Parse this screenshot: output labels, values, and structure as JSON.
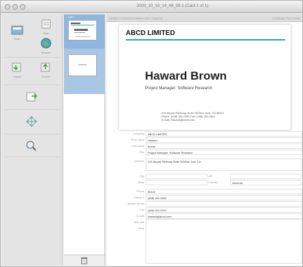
{
  "window": {
    "title": "2008_10_16_14_48_08-1 (Card 1 of 1)"
  },
  "toolbar": {
    "tools": [
      {
        "icon": "scan-icon",
        "label": "Scan"
      },
      {
        "icon": "new-card-icon",
        "label": "New"
      },
      {
        "icon": "globe-icon",
        "label": "Browse"
      },
      {
        "icon": "import-icon",
        "label": "Import"
      },
      {
        "icon": "export-icon",
        "label": "Export"
      }
    ],
    "rotate_icon": "rotate-icon",
    "fit_icon": "fit-arrows-icon",
    "zoom_icon": "zoom-icon"
  },
  "thumbnails": {
    "top_label": "Card",
    "trash_icon": "trash-icon"
  },
  "info_bar": {
    "left": "Quality of scanned business card: Adequate",
    "right": "Landscape  Print  Show"
  },
  "card": {
    "company": "ABCD LIMITED",
    "name": "Haward Brown",
    "title": "Project Manager: Software Research",
    "address_line": "226 Airport Parkway, Suite 250San Jose, CA 95110",
    "phone_line": "Phone: (408) 451-0000   Fax: (408) 451-0001",
    "email_line": "E-mail: Haward@abcd.com"
  },
  "form": {
    "fields": [
      {
        "label": "Company",
        "value": "ABCD LIMITED"
      },
      {
        "label": "First name",
        "value": "Haward"
      },
      {
        "label": "Last name",
        "value": "Brown"
      },
      {
        "label": "Title",
        "value": "Project Manager: Software Research"
      }
    ],
    "address": {
      "label": "Address",
      "value": "226 Airport Parkway Suite 250San Jose CA"
    },
    "city": {
      "label": "City",
      "value": ""
    },
    "state": {
      "label": "State",
      "value": ""
    },
    "zip": {
      "label": "ZIP",
      "value": ""
    },
    "country": {
      "label": "Country",
      "value": "Armenia"
    },
    "phone": {
      "label": "Phone",
      "value": "95110"
    },
    "phone2": {
      "label": "Phone 2",
      "value": "(408) 451-0000"
    },
    "mobile": {
      "label": "Mobile phone",
      "value": ""
    },
    "fax": {
      "label": "Fax",
      "value": "(408) 451-0001"
    },
    "email": {
      "label": "E-mail",
      "value": "haward@abcd.com"
    },
    "web": {
      "label": "Web site",
      "value": ""
    },
    "note": {
      "label": "Note",
      "value": ""
    }
  }
}
